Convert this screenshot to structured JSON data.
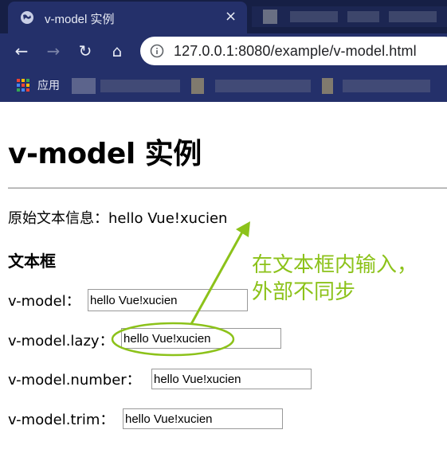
{
  "browser": {
    "tab_title": "v-model 实例",
    "tab_close": "×",
    "back": "←",
    "forward": "→",
    "reload": "↻",
    "home": "⌂",
    "url": "127.0.0.1:8080/example/v-model.html",
    "bookmarks_apps_label": "应用",
    "icons": [
      "globe-icon",
      "close-icon",
      "back-arrow-icon",
      "forward-arrow-icon",
      "reload-icon",
      "home-icon",
      "info-icon",
      "apps-grid-icon"
    ]
  },
  "page": {
    "title": "v-model 实例",
    "message_label": "原始文本信息：",
    "message_value": "hello Vue!xucien",
    "section_heading": "文本框",
    "fields": [
      {
        "label": "v-model：",
        "value": "hello Vue!xucien"
      },
      {
        "label": "v-model.lazy：",
        "value": "hello Vue!xucien"
      },
      {
        "label": "v-model.number：",
        "value": "hello Vue!xucien"
      },
      {
        "label": "v-model.trim：",
        "value": "hello Vue!xucien"
      }
    ]
  },
  "annotation": {
    "line1": "在文本框内输入，",
    "line2": "外部不同步",
    "color": "#8cc21a"
  },
  "colors": {
    "chrome_bg": "#24306a",
    "tabstrip_bg": "#161f45",
    "accent": "#8cc21a"
  }
}
